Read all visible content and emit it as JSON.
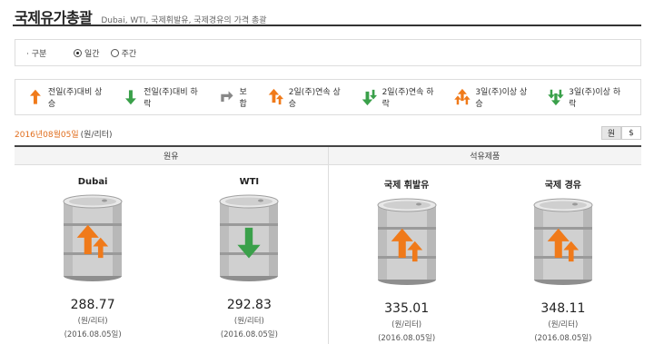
{
  "header": {
    "title": "국제유가총괄",
    "subtitle": "Dubai, WTI, 국제휘발유, 국제경유의 가격 총괄"
  },
  "options": {
    "label": "· 구분",
    "radios": [
      {
        "label": "일간",
        "selected": true
      },
      {
        "label": "주간",
        "selected": false
      }
    ]
  },
  "legend": [
    {
      "label": "전일(주)대비 상승",
      "icon": "arrow-up-icon"
    },
    {
      "label": "전일(주)대비 하락",
      "icon": "arrow-down-icon"
    },
    {
      "label": "보합",
      "icon": "flat-icon"
    },
    {
      "label": "2일(주)연속 상승",
      "icon": "double-up-icon"
    },
    {
      "label": "2일(주)연속 하락",
      "icon": "double-down-icon"
    },
    {
      "label": "3일(주)이상 상승",
      "icon": "triple-up-icon"
    },
    {
      "label": "3일(주)이상 하락",
      "icon": "triple-down-icon"
    }
  ],
  "date_row": {
    "date": "2016년08월05일",
    "unit": "(원/리터)",
    "unit_buttons": [
      {
        "label": "원",
        "active": true
      },
      {
        "label": "$",
        "active": false
      }
    ]
  },
  "sections": [
    {
      "title": "원유",
      "items": [
        {
          "name": "Dubai",
          "price": "288.77",
          "unit": "(원/리터)",
          "date": "(2016.08.05일)",
          "trend": "double-up-icon"
        },
        {
          "name": "WTI",
          "price": "292.83",
          "unit": "(원/리터)",
          "date": "(2016.08.05일)",
          "trend": "arrow-down-icon"
        }
      ]
    },
    {
      "title": "석유제품",
      "items": [
        {
          "name": "국제 휘발유",
          "price": "335.01",
          "unit": "(원/리터)",
          "date": "(2016.08.05일)",
          "trend": "double-up-icon"
        },
        {
          "name": "국제 경유",
          "price": "348.11",
          "unit": "(원/리터)",
          "date": "(2016.08.05일)",
          "trend": "double-up-icon"
        }
      ]
    }
  ],
  "colors": {
    "up": "#f07a1a",
    "down": "#3aa04a",
    "flat": "#888888",
    "date_accent": "#e06d1c"
  }
}
